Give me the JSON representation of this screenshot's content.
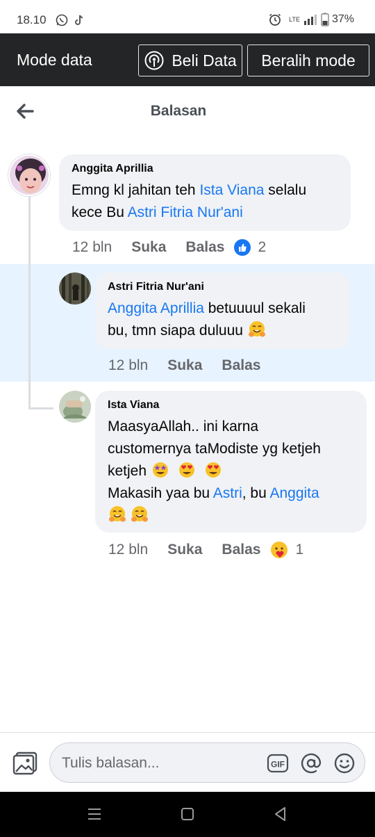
{
  "status_bar": {
    "time": "18.10",
    "network": "LTE",
    "battery": "37%"
  },
  "data_mode": {
    "title": "Mode data",
    "buy_label": "Beli Data",
    "switch_label": "Beralih mode"
  },
  "header": {
    "title": "Balasan"
  },
  "comments": [
    {
      "author": "Anggita Aprillia",
      "line1_a": "Emng kl jahitan teh ",
      "line1_mention": "Ista Viana",
      "line1_b": " selalu",
      "line2_a": "kece Bu ",
      "line2_mention": "Astri Fitria Nur'ani",
      "time": "12 bln",
      "like": "Suka",
      "reply": "Balas",
      "reaction_icon": "like-reaction",
      "reaction_count": "2"
    },
    {
      "author": "Astri Fitria Nur'ani",
      "line1_mention": "Anggita Aprillia",
      "line1_b": " betuuuul sekali",
      "line2_a": "bu, tmn siapa duluuu",
      "line2_emojis": [
        "hug-emoji"
      ],
      "time": "12 bln",
      "like": "Suka",
      "reply": "Balas"
    },
    {
      "author": "Ista Viana",
      "line1": "MaasyaAllah.. ini karna",
      "line2": "customernya taModiste yg ketjeh",
      "line3": "ketjeh",
      "line3_emojis": [
        "star-struck-emoji",
        "heart-eyes-emoji",
        "heart-eyes-emoji"
      ],
      "line4_a": "Makasih yaa bu ",
      "line4_mention1": "Astri",
      "line4_b": ", bu ",
      "line4_mention2": "Anggita",
      "line5_emojis": [
        "hug-emoji",
        "hug-emoji"
      ],
      "time": "12 bln",
      "like": "Suka",
      "reply": "Balas",
      "reaction_icon": "care-reaction",
      "reaction_count": "1"
    }
  ],
  "composer": {
    "placeholder": "Tulis balasan...",
    "icons": [
      "photo-icon",
      "gif-icon",
      "mention-icon",
      "emoji-icon"
    ]
  },
  "colors": {
    "accent": "#1877f2",
    "bubble": "#f0f2f5",
    "highlight": "#e7f3ff",
    "dark_bar": "#242526",
    "meta": "#65676b"
  }
}
